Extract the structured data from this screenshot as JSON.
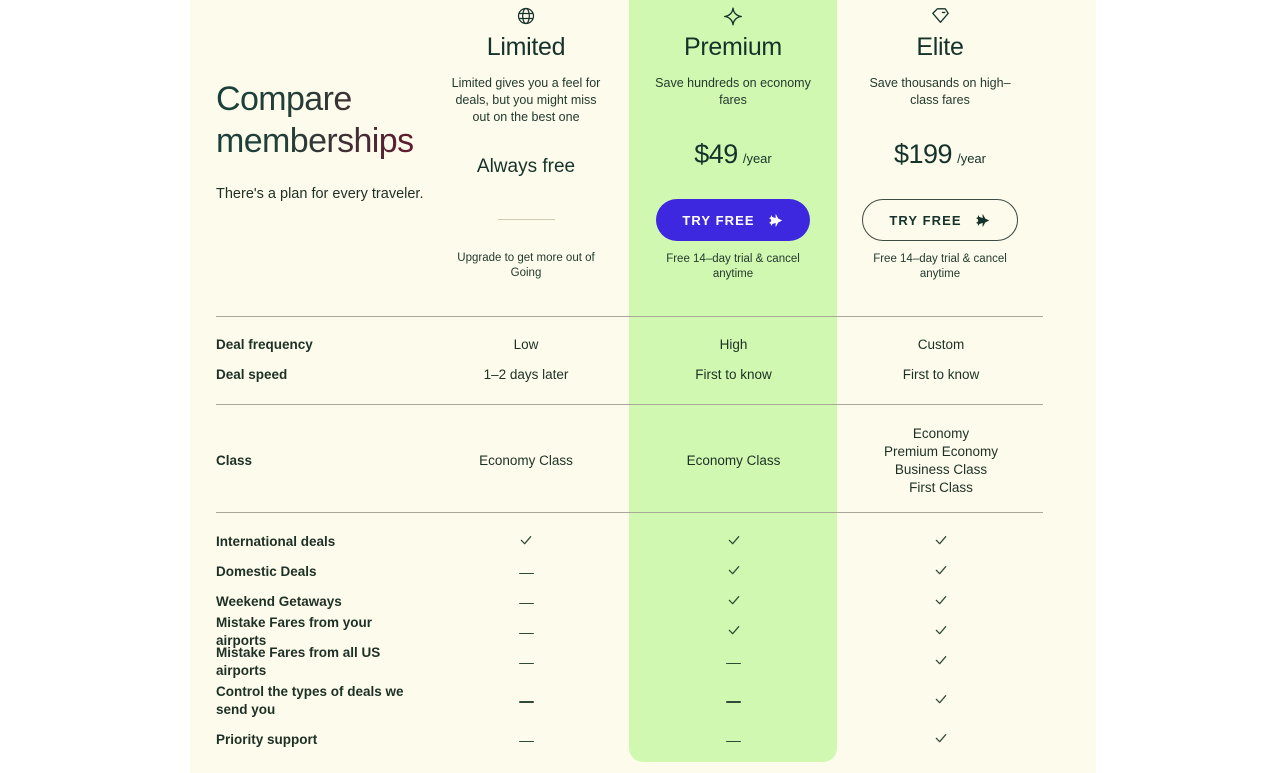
{
  "header": {
    "title_line1": "Compare",
    "title_line2": "memberships",
    "subtitle": "There's a plan for every traveler."
  },
  "plans": [
    {
      "id": "limited",
      "icon": "globe-icon",
      "name": "Limited",
      "description": "Limited gives you a feel for deals, but you might miss out on the best one",
      "price_text": "Always free",
      "note": "Upgrade to get more out of Going"
    },
    {
      "id": "premium",
      "icon": "sparkle-icon",
      "name": "Premium",
      "description": "Save hundreds on economy fares",
      "price": "$49",
      "period": "/year",
      "cta_label": "TRY FREE",
      "cta_icon": "plane-icon",
      "note": "Free 14–day trial & cancel anytime",
      "highlight_color": "#d1f8b0",
      "cta_color": "#3d28e0"
    },
    {
      "id": "elite",
      "icon": "gem-icon",
      "name": "Elite",
      "description": "Save thousands on high–class fares",
      "price": "$199",
      "period": "/year",
      "cta_label": "TRY FREE",
      "cta_icon": "plane-icon",
      "note": "Free 14–day trial & cancel anytime"
    }
  ],
  "sections": {
    "speed": {
      "rows": [
        {
          "label": "Deal frequency",
          "limited": "Low",
          "premium": "High",
          "elite": "Custom"
        },
        {
          "label": "Deal speed",
          "limited": "1–2 days later",
          "premium": "First to know",
          "elite": "First to know"
        }
      ]
    },
    "class": {
      "label": "Class",
      "limited": "Economy Class",
      "premium": "Economy Class",
      "elite_lines": [
        "Economy",
        "Premium Economy",
        "Business Class",
        "First Class"
      ]
    },
    "features": {
      "rows": [
        {
          "label": "International deals",
          "limited": "check",
          "premium": "check",
          "elite": "check"
        },
        {
          "label": "Domestic Deals",
          "limited": "dash",
          "premium": "check",
          "elite": "check"
        },
        {
          "label": "Weekend Getaways",
          "limited": "dash",
          "premium": "check",
          "elite": "check"
        },
        {
          "label": "Mistake Fares from your airports",
          "limited": "dash",
          "premium": "check",
          "elite": "check"
        },
        {
          "label": "Mistake Fares from all US airports",
          "limited": "dash",
          "premium": "dash",
          "elite": "check"
        },
        {
          "label": "Control the types of deals we send you",
          "limited": "dash",
          "premium": "dash",
          "elite": "check"
        },
        {
          "label": "Priority support",
          "limited": "dash",
          "premium": "dash",
          "elite": "check"
        }
      ]
    }
  },
  "colors": {
    "panel_background": "#fdfbeb",
    "premium_band": "#d1f8b0",
    "text": "#1d3026",
    "heading_start": "#17403a",
    "heading_end": "#7a0f2b",
    "divider": "#a9a79a",
    "cta_primary": "#3d28e0"
  }
}
